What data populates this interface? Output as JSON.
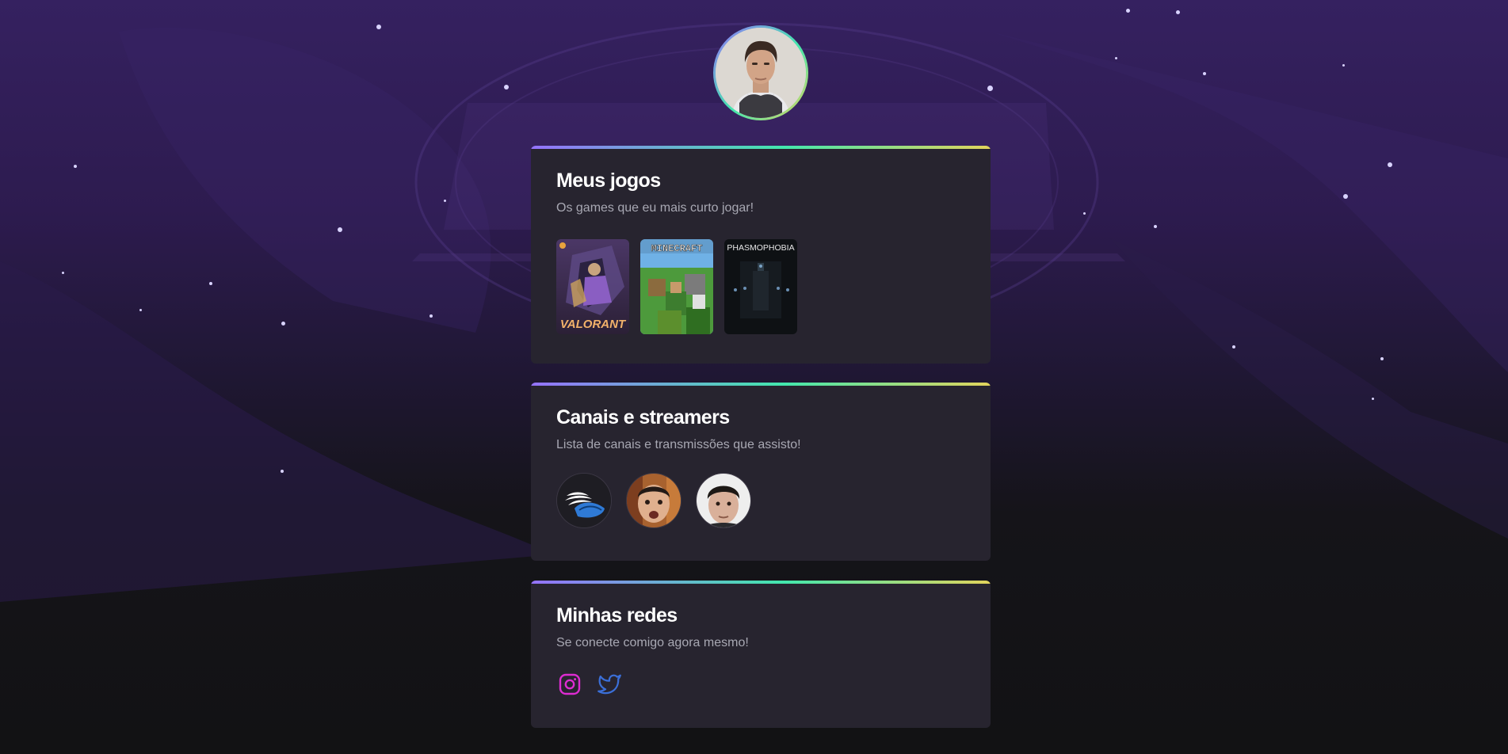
{
  "profile": {
    "avatar_icon": "profile-photo"
  },
  "games_section": {
    "title": "Meus jogos",
    "subtitle": "Os games que eu mais curto jogar!",
    "games": [
      {
        "name": "VALORANT",
        "icon": "valorant-cover"
      },
      {
        "name": "MINECRAFT",
        "icon": "minecraft-cover"
      },
      {
        "name": "PHASMOPHOBIA",
        "icon": "phasmophobia-cover"
      }
    ]
  },
  "streamers_section": {
    "title": "Canais e streamers",
    "subtitle": "Lista de canais e transmissões que assisto!",
    "streamers": [
      {
        "icon": "winged-shoe-logo"
      },
      {
        "icon": "streamer-avatar"
      },
      {
        "icon": "streamer-avatar"
      }
    ]
  },
  "socials_section": {
    "title": "Minhas redes",
    "subtitle": "Se conecte comigo agora mesmo!",
    "links": [
      {
        "icon": "instagram-icon",
        "color": "#dd2cd1"
      },
      {
        "icon": "twitter-icon",
        "color": "#3b6fd8"
      }
    ]
  },
  "colors": {
    "card_background": "#27242f",
    "gradient_start": "#9572fc",
    "gradient_mid": "#43e7ad",
    "gradient_end": "#e2d45c",
    "page_background_top": "#352160",
    "page_background_bottom": "#121214"
  }
}
